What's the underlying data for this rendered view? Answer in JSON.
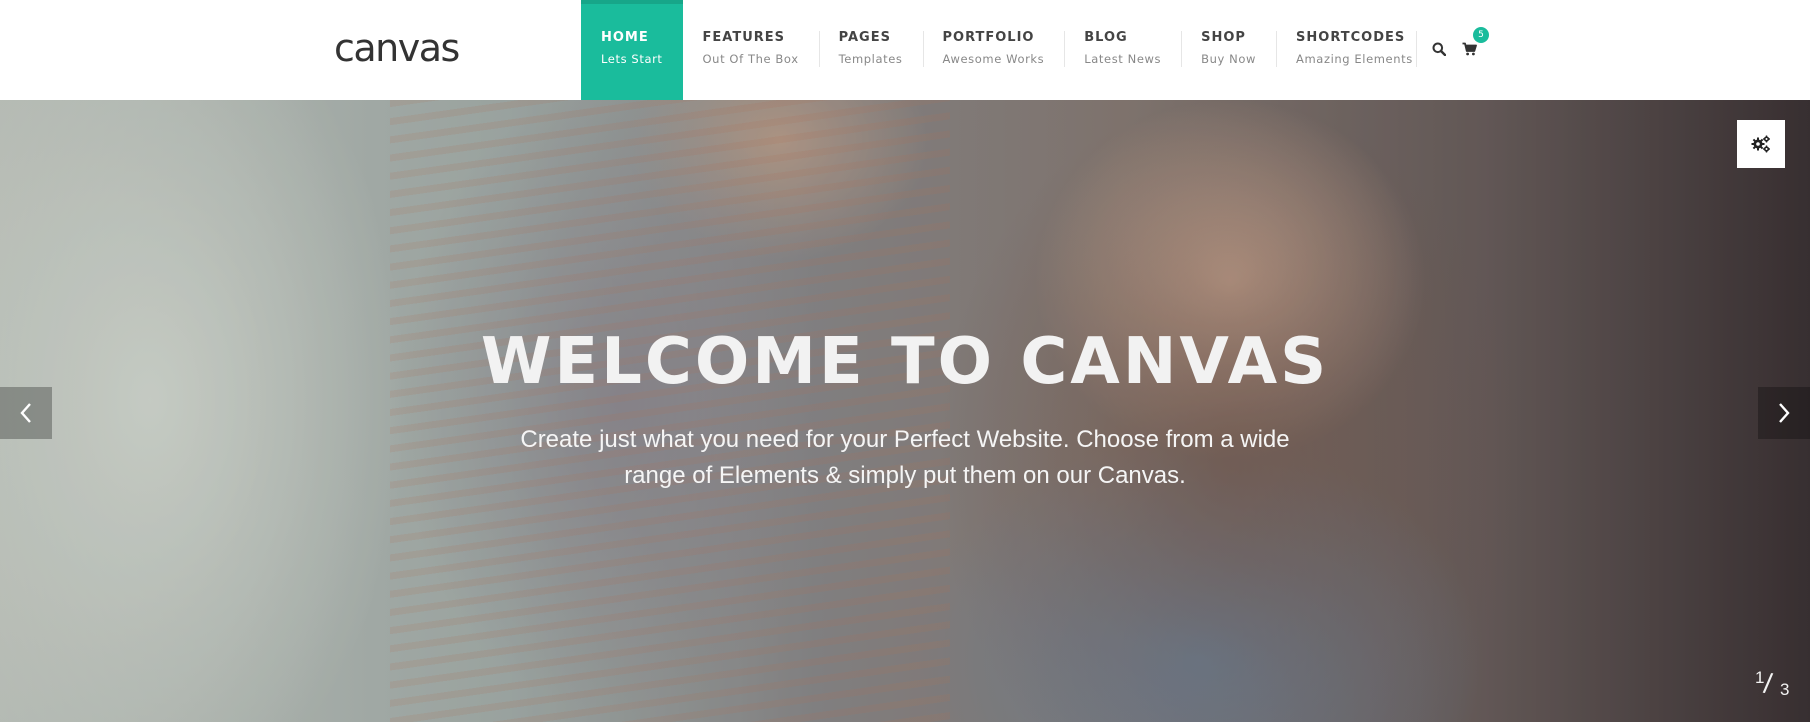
{
  "header": {
    "logo_text": "canvas",
    "nav": [
      {
        "label": "HOME",
        "sub": "Lets Start",
        "active": true
      },
      {
        "label": "FEATURES",
        "sub": "Out Of The Box"
      },
      {
        "label": "PAGES",
        "sub": "Templates"
      },
      {
        "label": "PORTFOLIO",
        "sub": "Awesome Works"
      },
      {
        "label": "BLOG",
        "sub": "Latest News"
      },
      {
        "label": "SHOP",
        "sub": "Buy Now"
      },
      {
        "label": "SHORTCODES",
        "sub": "Amazing Elements"
      }
    ],
    "search_icon": "search-icon",
    "cart_icon": "cart-icon",
    "cart_count": "5"
  },
  "hero": {
    "title": "WELCOME TO CANVAS",
    "text": "Create just what you need for your Perfect Website. Choose from a wide range of Elements & simply put them on our Canvas.",
    "prev_icon": "chevron-left-icon",
    "next_icon": "chevron-right-icon",
    "settings_icon": "gears-icon",
    "slide_current": "1",
    "slide_total": "3"
  },
  "colors": {
    "accent": "#1abc9c",
    "nav_text": "#444444",
    "nav_sub_text": "#888888"
  }
}
